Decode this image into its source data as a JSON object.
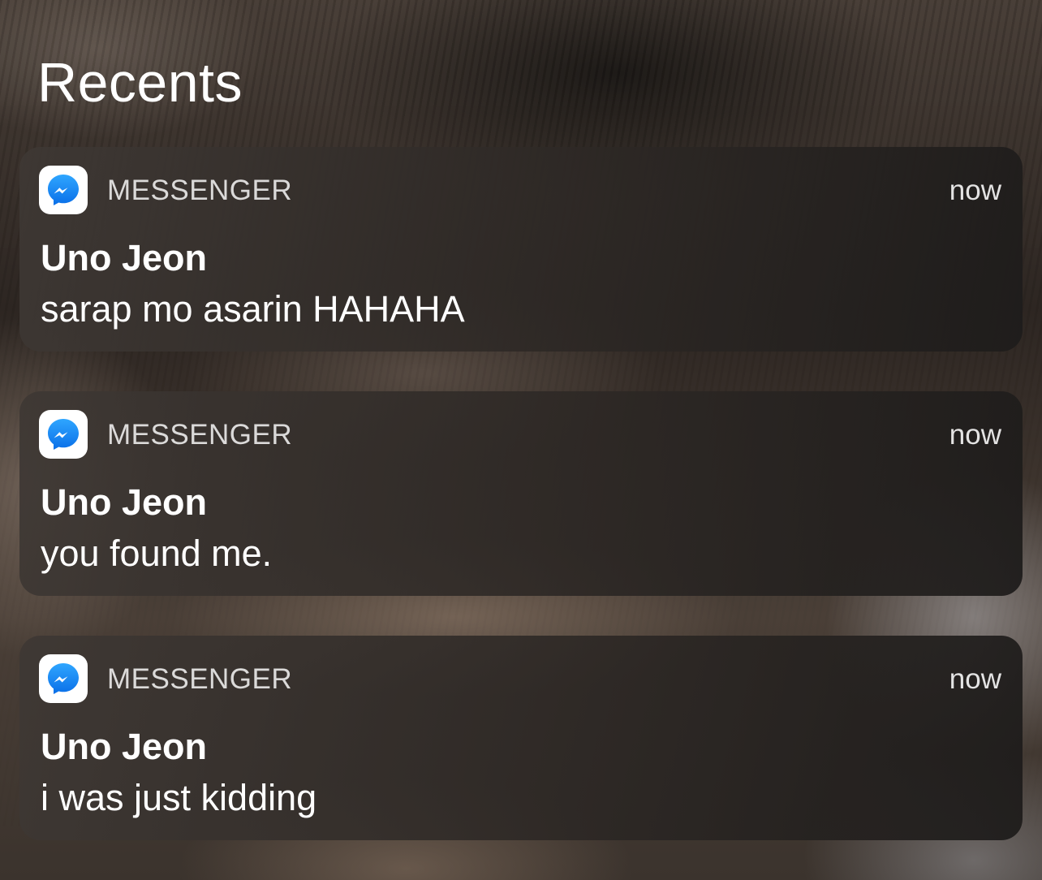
{
  "header": {
    "title": "Recents"
  },
  "notifications": [
    {
      "app_name": "MESSENGER",
      "app_icon": "messenger-icon",
      "time": "now",
      "sender": "Uno Jeon",
      "message": "sarap mo asarin HAHAHA"
    },
    {
      "app_name": "MESSENGER",
      "app_icon": "messenger-icon",
      "time": "now",
      "sender": "Uno Jeon",
      "message": "you found me."
    },
    {
      "app_name": "MESSENGER",
      "app_icon": "messenger-icon",
      "time": "now",
      "sender": "Uno Jeon",
      "message": "i was just kidding"
    }
  ],
  "colors": {
    "messenger_blue": "#1c8cf9",
    "text": "#ffffff"
  }
}
